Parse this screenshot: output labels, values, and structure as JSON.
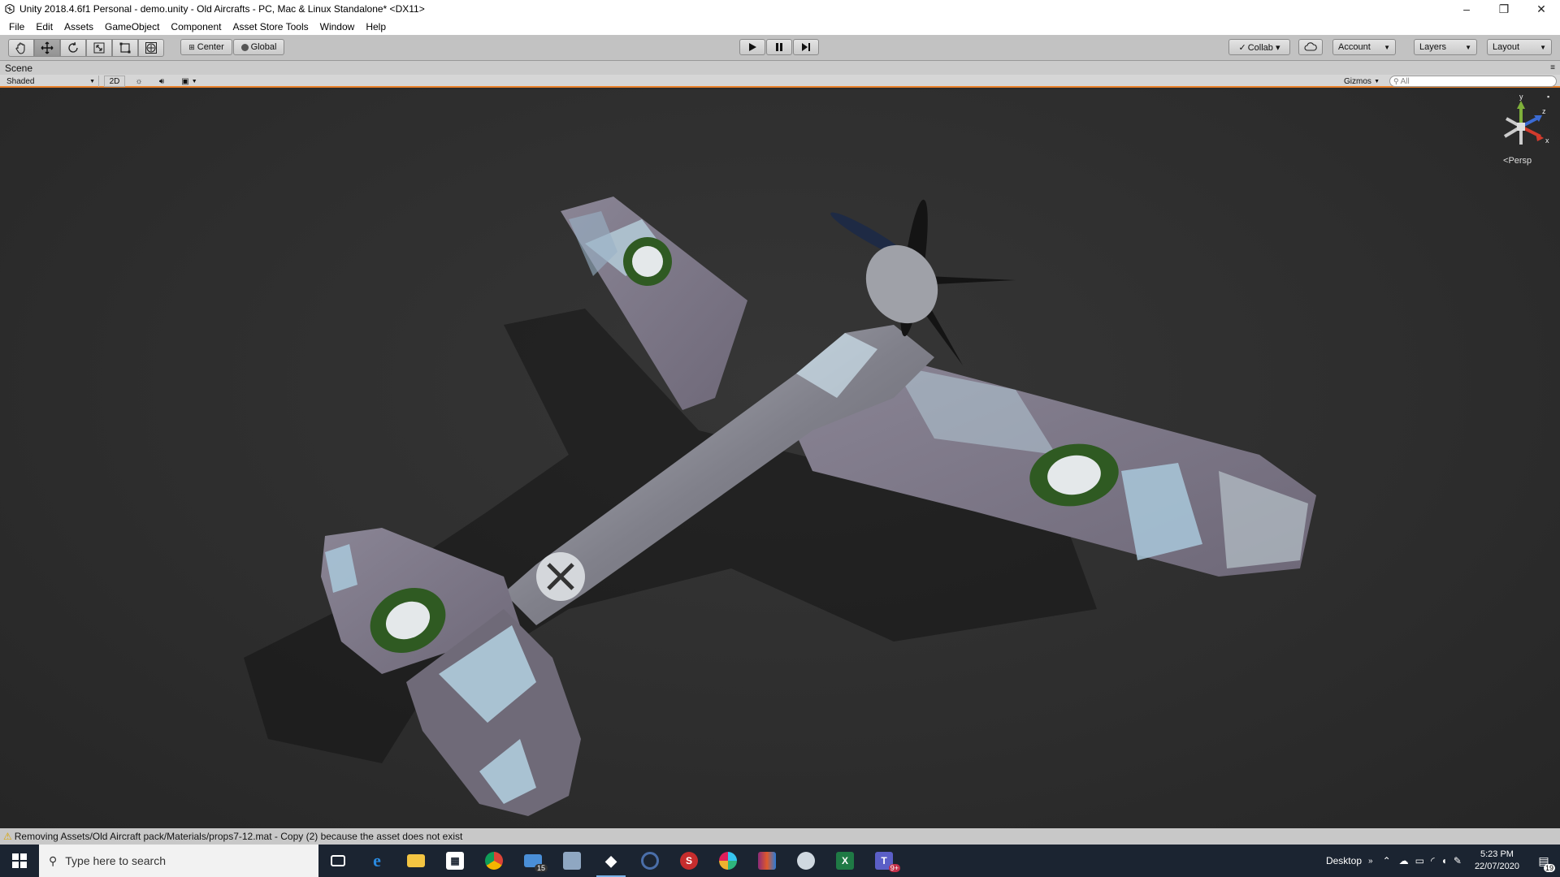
{
  "window": {
    "title": "Unity 2018.4.6f1 Personal - demo.unity - Old Aircrafts - PC, Mac & Linux Standalone* <DX11>",
    "minimize": "–",
    "maximize": "❐",
    "close": "✕"
  },
  "menu": [
    "File",
    "Edit",
    "Assets",
    "GameObject",
    "Component",
    "Asset Store Tools",
    "Window",
    "Help"
  ],
  "toolbar": {
    "pivot_label": "Center",
    "space_label": "Global",
    "collab_label": "Collab ▾",
    "account_label": "Account",
    "layers_label": "Layers",
    "layout_label": "Layout"
  },
  "scene": {
    "tab_label": "Scene",
    "shading_mode": "Shaded",
    "mode_2d": "2D",
    "gizmos_label": "Gizmos",
    "search_placeholder": "All",
    "persp_label": "Persp",
    "axis_y": "y",
    "axis_z": "z",
    "axis_x": "x"
  },
  "status": {
    "message": "Removing Assets/Old Aircraft pack/Materials/props7-12.mat - Copy (2) because the asset does not exist"
  },
  "taskbar": {
    "search_placeholder": "Type here to search",
    "mail_badge": "15",
    "teams_badge": "9+",
    "desktop_label": "Desktop",
    "time": "5:23 PM",
    "date": "22/07/2020",
    "notif_count": "19"
  },
  "colors": {
    "accent_orange": "#e8802a",
    "taskbar_bg": "#1b2431",
    "roundel_green": "#2f5a22",
    "camo_light": "#a9c8da",
    "camo_dark": "#6e6672"
  }
}
